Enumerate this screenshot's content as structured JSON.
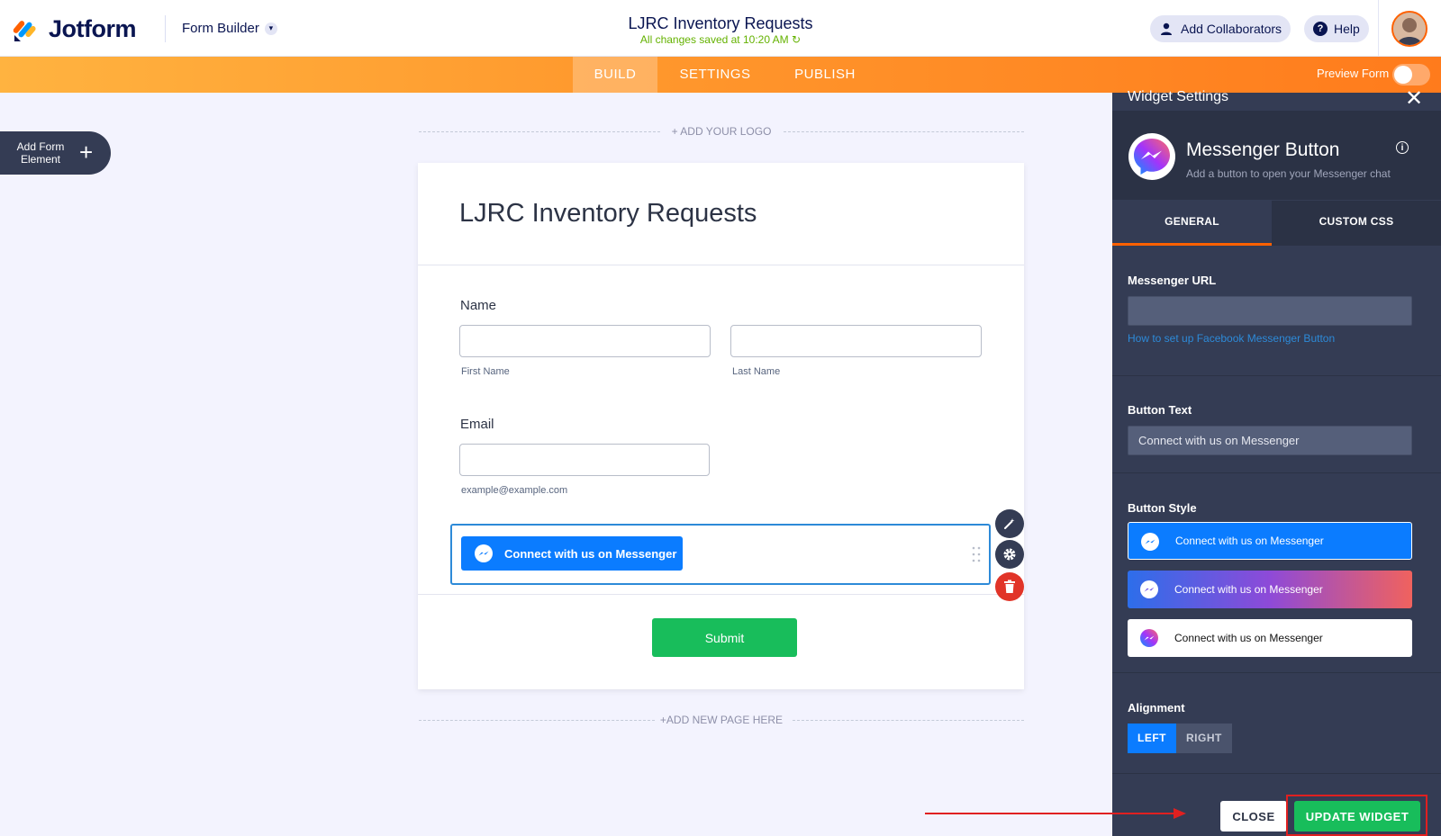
{
  "header": {
    "brand": "Jotform",
    "builder_menu": "Form Builder",
    "form_title": "LJRC Inventory Requests",
    "save_status": "All changes saved at 10:20 AM",
    "add_collaborators": "Add Collaborators",
    "help": "Help"
  },
  "nav": {
    "tabs": [
      "BUILD",
      "SETTINGS",
      "PUBLISH"
    ],
    "active_tab": "BUILD",
    "preview_label": "Preview Form",
    "preview_on": false
  },
  "sidebar": {
    "add_element_label": "Add Form Element"
  },
  "canvas": {
    "add_logo": "+ ADD YOUR LOGO",
    "add_page": "+ADD NEW PAGE HERE",
    "form_heading": "LJRC Inventory Requests",
    "name_label": "Name",
    "first_name_sub": "First Name",
    "last_name_sub": "Last Name",
    "email_label": "Email",
    "email_sub": "example@example.com",
    "messenger_button": "Connect with us on Messenger",
    "submit": "Submit"
  },
  "panel": {
    "title": "Widget Settings",
    "widget_name": "Messenger Button",
    "widget_desc": "Add a button to open your Messenger chat",
    "tabs": [
      "GENERAL",
      "CUSTOM CSS"
    ],
    "active_tab": "GENERAL",
    "messenger_url_label": "Messenger URL",
    "messenger_url_value": "",
    "help_link": "How to set up Facebook Messenger Button",
    "button_text_label": "Button Text",
    "button_text_value": "Connect with us on Messenger",
    "button_style_label": "Button Style",
    "style_options": [
      "Connect with us on Messenger",
      "Connect with us on Messenger",
      "Connect with us on Messenger"
    ],
    "selected_style": 0,
    "alignment_label": "Alignment",
    "alignment_options": [
      "LEFT",
      "RIGHT"
    ],
    "selected_alignment": "LEFT",
    "close": "CLOSE",
    "update": "UPDATE WIDGET"
  },
  "colors": {
    "accent_orange": "#ff7b1c",
    "messenger_blue": "#0b7cff",
    "submit_green": "#18bd5b",
    "panel_bg": "#343c54",
    "annotation_red": "#e02020"
  }
}
